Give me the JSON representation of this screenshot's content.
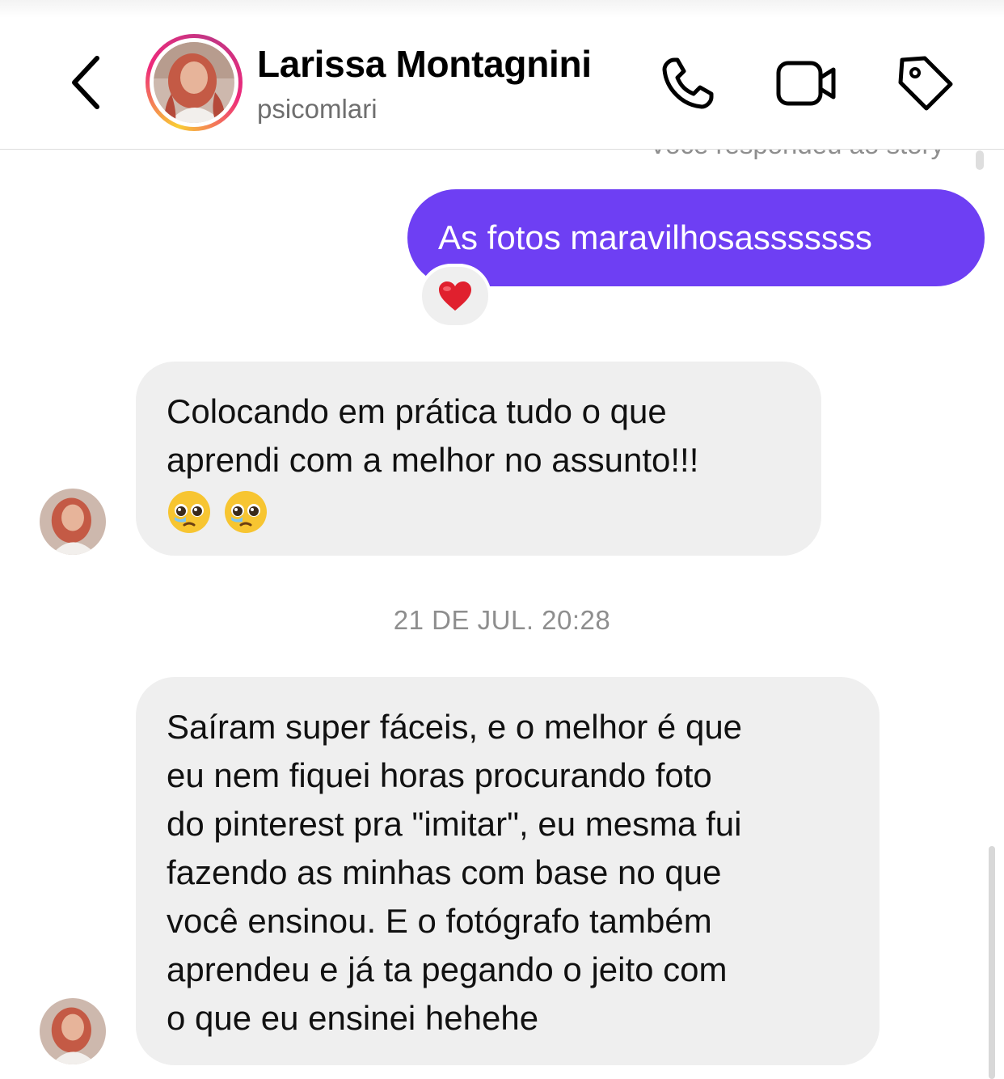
{
  "header": {
    "back_icon": "chevron-left-icon",
    "contact_name": "Larissa Montagnini",
    "username": "psicomlari",
    "call_icon": "phone-icon",
    "video_icon": "video-camera-icon",
    "tag_icon": "tag-icon",
    "story_ring_colors": [
      "#f9ce34",
      "#ee2a7b",
      "#c13584"
    ]
  },
  "chat": {
    "story_reply_label": "Você respondeu ao story",
    "outgoing_message": "As fotos maravilhosasssssss",
    "outgoing_bubble_color": "#6e3ff3",
    "reaction_emoji": "❤️",
    "message_1": {
      "lines": [
        "Colocando em prática tudo o que",
        "aprendi com a melhor no assunto!!!"
      ],
      "emojis": [
        "🥹",
        "🥹"
      ]
    },
    "timestamp": "21 DE JUL. 20:28",
    "message_2": {
      "lines": [
        "Saíram super fáceis, e o melhor é que",
        "eu nem fiquei horas procurando foto",
        "do pinterest pra \"imitar\", eu mesma fui",
        "fazendo as minhas com base no que",
        "você ensinou. E o fotógrafo também",
        "aprendeu e já ta pegando o jeito com",
        "o que eu ensinei hehehe"
      ]
    },
    "incoming_bubble_color": "#efefef"
  }
}
